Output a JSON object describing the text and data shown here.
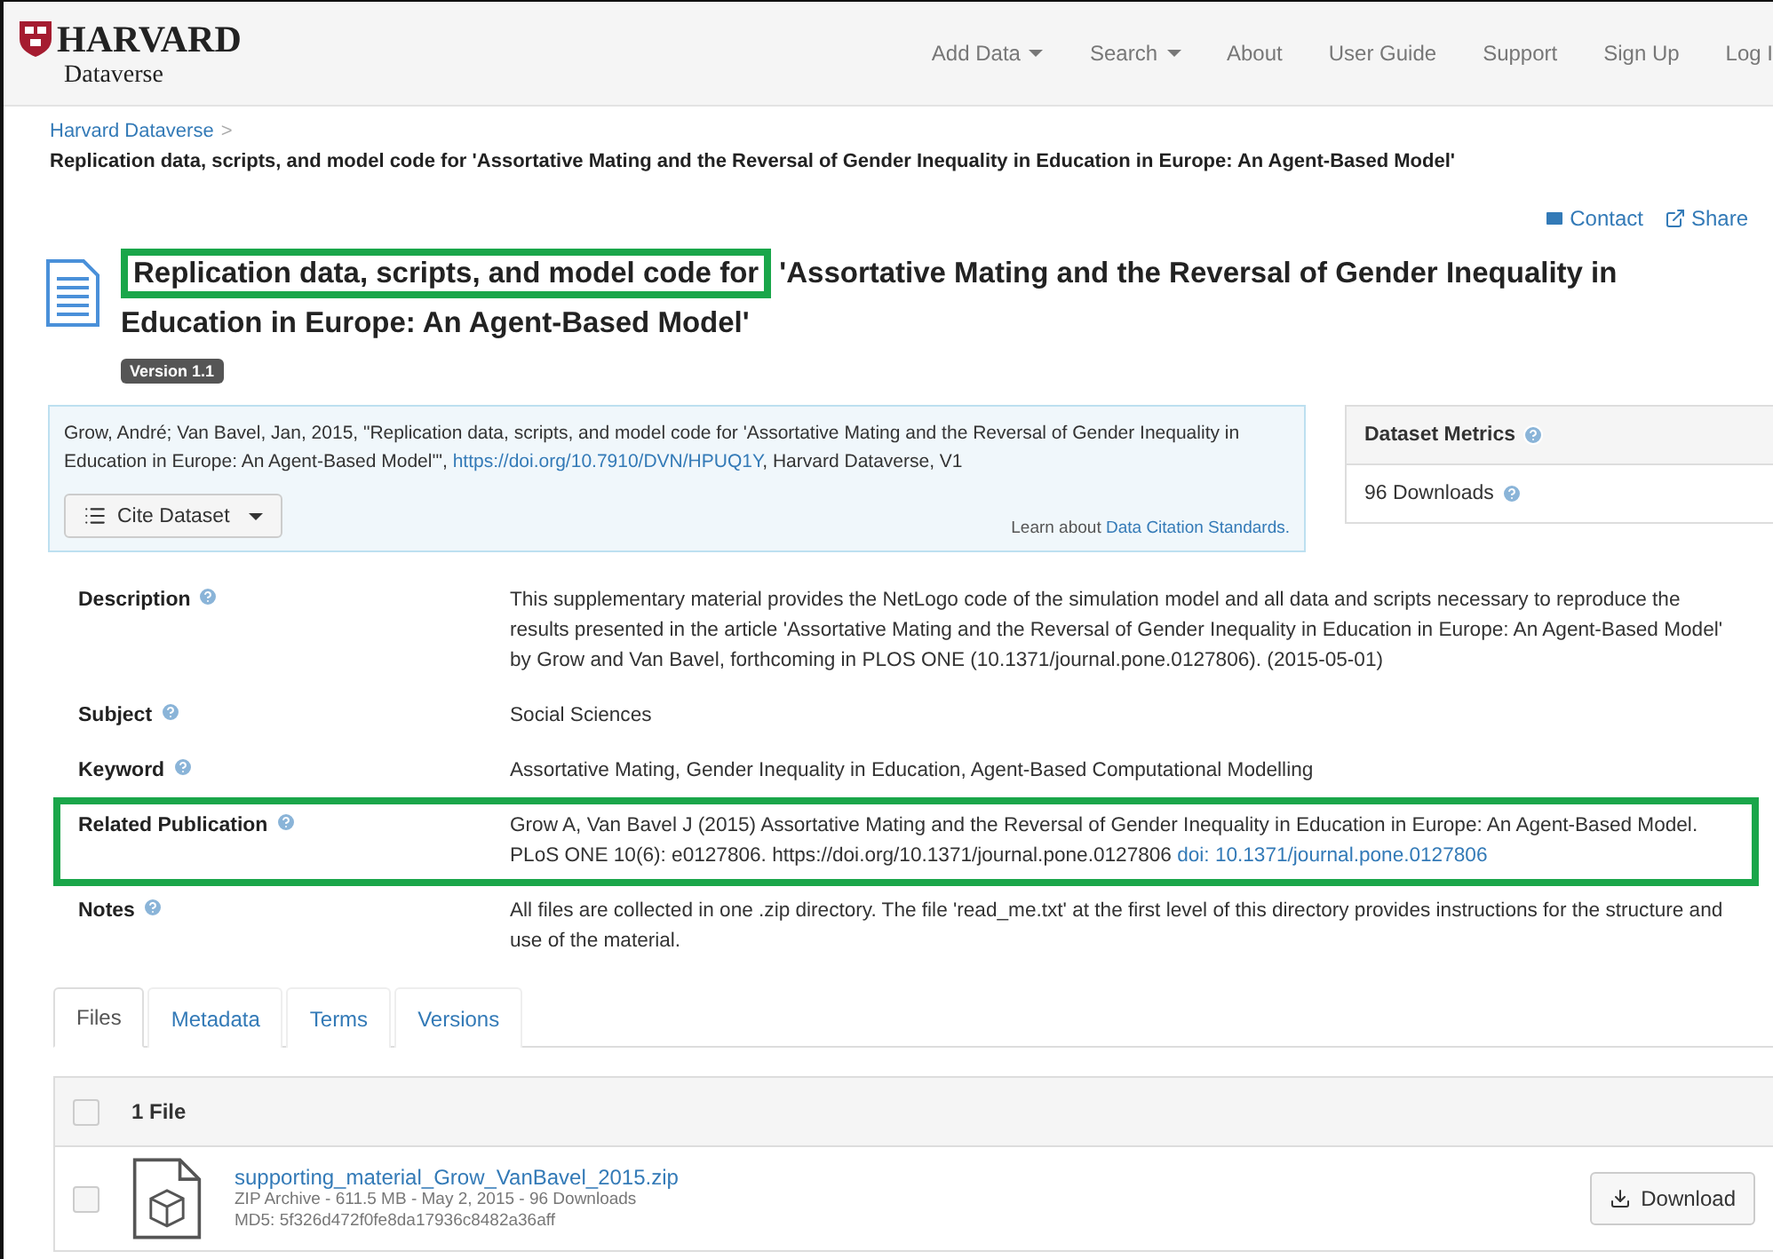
{
  "header": {
    "logo": {
      "name": "HARVARD",
      "sub": "Dataverse"
    },
    "nav": [
      {
        "label": "Add Data",
        "dropdown": true
      },
      {
        "label": "Search",
        "dropdown": true
      },
      {
        "label": "About",
        "dropdown": false
      },
      {
        "label": "User Guide",
        "dropdown": false
      },
      {
        "label": "Support",
        "dropdown": false
      },
      {
        "label": "Sign Up",
        "dropdown": false
      },
      {
        "label": "Log I",
        "dropdown": false
      }
    ]
  },
  "breadcrumb": {
    "link": "Harvard Dataverse",
    "separator": ">",
    "current": "Replication data, scripts, and model code for 'Assortative Mating and the Reversal of Gender Inequality in Education in Europe: An Agent-Based Model'"
  },
  "actions": [
    "Contact",
    "Share"
  ],
  "title": {
    "highlighted_part": "Replication data, scripts, and model code for",
    "rest": "'Assortative Mating and the Reversal of Gender Inequality in Education in Europe: An Agent-Based Model'",
    "version": "Version 1.1"
  },
  "citation": {
    "before": "Grow, André; Van Bavel, Jan, 2015, \"Replication data, scripts, and model code for 'Assortative Mating and the Reversal of Gender Inequality in Education in Europe: An Agent-Based Model'\",",
    "link": "https://doi.org/10.7910/DVN/HPUQ1Y",
    "after": ", Harvard Dataverse, V1",
    "button": "Cite Dataset",
    "learn_text": "Learn about",
    "learn_link": "Data Citation Standards."
  },
  "metrics": {
    "title": "Dataset Metrics",
    "downloads": "96 Downloads"
  },
  "metadata": [
    {
      "label": "Description",
      "value": "This supplementary material provides the NetLogo code of the simulation model and all data and scripts necessary to reproduce the results presented in the article 'Assortative Mating and the Reversal of Gender Inequality in Education in Europe: An Agent-Based Model' by Grow and Van Bavel, forthcoming in PLOS ONE (10.1371/journal.pone.0127806). (2015-05-01)",
      "highlighted": false
    },
    {
      "label": "Subject",
      "value": "Social Sciences",
      "highlighted": false
    },
    {
      "label": "Keyword",
      "value": "Assortative Mating, Gender Inequality in Education, Agent-Based Computational Modelling",
      "highlighted": false
    },
    {
      "label": "Related Publication",
      "value": "Grow A, Van Bavel J (2015) Assortative Mating and the Reversal of Gender Inequality in Education in Europe: An Agent-Based Model. PLoS ONE 10(6): e0127806. https://doi.org/10.1371/journal.pone.0127806",
      "link": "doi: 10.1371/journal.pone.0127806",
      "highlighted": true
    },
    {
      "label": "Notes",
      "value": "All files are collected in one .zip directory. The file 'read_me.txt' at the first level of this directory provides instructions for the structure and use of the material.",
      "highlighted": false
    }
  ],
  "tabs": [
    {
      "label": "Files",
      "selected": true
    },
    {
      "label": "Metadata",
      "selected": false
    },
    {
      "label": "Terms",
      "selected": false
    },
    {
      "label": "Versions",
      "selected": false
    }
  ],
  "files": {
    "count": "1 File",
    "all_checked": false,
    "items": [
      {
        "name": "supporting_material_Grow_VanBavel_2015.zip",
        "info": "ZIP Archive - 611.5 MB - May 2, 2015 - 96 Downloads",
        "md5": "MD5: 5f326d472f0fe8da17936c8482a36aff",
        "checked": false,
        "action": "Download"
      }
    ]
  }
}
